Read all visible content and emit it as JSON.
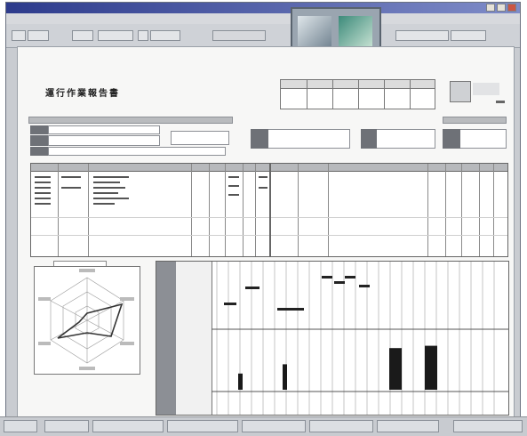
{
  "window": {
    "title": "",
    "menu": ""
  },
  "toolbar": {
    "buttons": [
      "",
      "",
      "",
      "",
      "",
      "",
      "",
      "",
      ""
    ]
  },
  "document": {
    "title": "運行作業報告書",
    "subtitle": "",
    "header_cols": [
      "",
      "",
      "",
      "",
      "",
      ""
    ]
  },
  "timeline": {
    "spikes": [
      0.35,
      0.55,
      0.9,
      0.95
    ]
  },
  "taskbar": {
    "start": "",
    "items": [
      "",
      "",
      "",
      "",
      "",
      "",
      ""
    ]
  },
  "colors": {
    "titlebar": "#2d3b8c",
    "doc_bg": "#f7f7f6",
    "header_gray": "#b7b9bc"
  }
}
